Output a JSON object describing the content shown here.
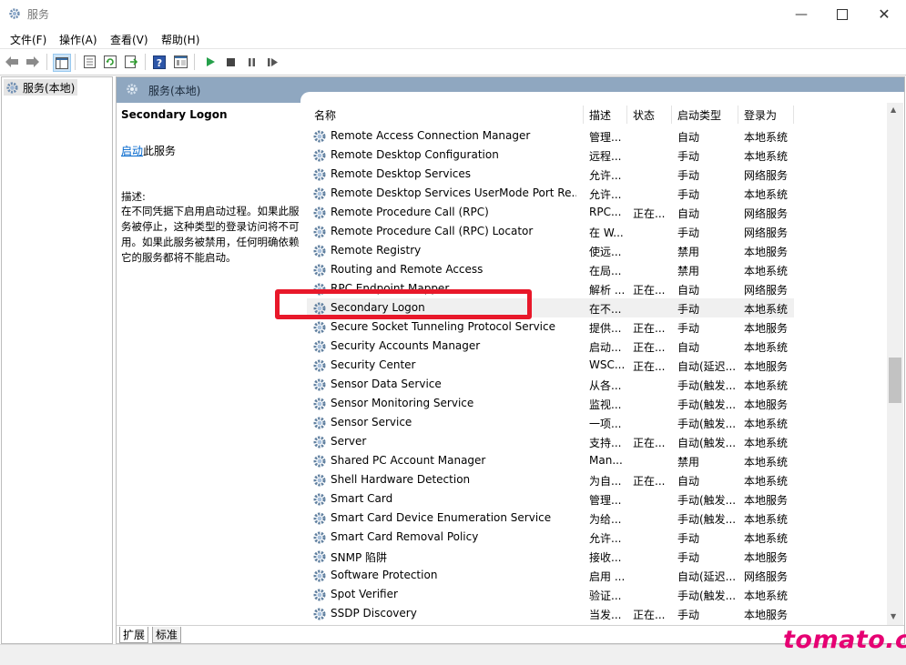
{
  "window": {
    "title": "服务"
  },
  "menu": [
    "文件(F)",
    "操作(A)",
    "查看(V)",
    "帮助(H)"
  ],
  "toolbar_icons": [
    "back-arrow-icon",
    "forward-arrow-icon",
    "show-console-tree-icon",
    "properties-icon",
    "refresh-icon",
    "export-list-icon",
    "help-icon",
    "extended-view-icon",
    "start-service-icon",
    "stop-service-icon",
    "pause-service-icon",
    "restart-service-icon"
  ],
  "tree": {
    "item": "服务(本地)"
  },
  "pane": {
    "header": "服务(本地)"
  },
  "desc": {
    "title": "Secondary Logon",
    "start_link": "启动",
    "start_suffix": "此服务",
    "label": "描述:",
    "body": "在不同凭据下启用启动过程。如果此服务被停止，这种类型的登录访问将不可用。如果此服务被禁用，任何明确依赖它的服务都将不能启动。"
  },
  "columns": {
    "name": "名称",
    "desc": "描述",
    "status": "状态",
    "startup": "启动类型",
    "logon": "登录为"
  },
  "services": [
    {
      "name": "Remote Access Connection Manager",
      "desc": "管理...",
      "status": "",
      "startup": "自动",
      "logon": "本地系统"
    },
    {
      "name": "Remote Desktop Configuration",
      "desc": "远程...",
      "status": "",
      "startup": "手动",
      "logon": "本地系统"
    },
    {
      "name": "Remote Desktop Services",
      "desc": "允许...",
      "status": "",
      "startup": "手动",
      "logon": "网络服务"
    },
    {
      "name": "Remote Desktop Services UserMode Port Re...",
      "desc": "允许...",
      "status": "",
      "startup": "手动",
      "logon": "本地系统"
    },
    {
      "name": "Remote Procedure Call (RPC)",
      "desc": "RPC...",
      "status": "正在...",
      "startup": "自动",
      "logon": "网络服务"
    },
    {
      "name": "Remote Procedure Call (RPC) Locator",
      "desc": "在 W...",
      "status": "",
      "startup": "手动",
      "logon": "网络服务"
    },
    {
      "name": "Remote Registry",
      "desc": "使远...",
      "status": "",
      "startup": "禁用",
      "logon": "本地服务"
    },
    {
      "name": "Routing and Remote Access",
      "desc": "在局...",
      "status": "",
      "startup": "禁用",
      "logon": "本地系统"
    },
    {
      "name": "RPC Endpoint Mapper",
      "desc": "解析 ...",
      "status": "正在...",
      "startup": "自动",
      "logon": "网络服务"
    },
    {
      "name": "Secondary Logon",
      "desc": "在不...",
      "status": "",
      "startup": "手动",
      "logon": "本地系统"
    },
    {
      "name": "Secure Socket Tunneling Protocol Service",
      "desc": "提供...",
      "status": "正在...",
      "startup": "手动",
      "logon": "本地服务"
    },
    {
      "name": "Security Accounts Manager",
      "desc": "启动...",
      "status": "正在...",
      "startup": "自动",
      "logon": "本地系统"
    },
    {
      "name": "Security Center",
      "desc": "WSC...",
      "status": "正在...",
      "startup": "自动(延迟...",
      "logon": "本地服务"
    },
    {
      "name": "Sensor Data Service",
      "desc": "从各...",
      "status": "",
      "startup": "手动(触发...",
      "logon": "本地系统"
    },
    {
      "name": "Sensor Monitoring Service",
      "desc": "监视...",
      "status": "",
      "startup": "手动(触发...",
      "logon": "本地服务"
    },
    {
      "name": "Sensor Service",
      "desc": "一项...",
      "status": "",
      "startup": "手动(触发...",
      "logon": "本地系统"
    },
    {
      "name": "Server",
      "desc": "支持...",
      "status": "正在...",
      "startup": "自动(触发...",
      "logon": "本地系统"
    },
    {
      "name": "Shared PC Account Manager",
      "desc": "Man...",
      "status": "",
      "startup": "禁用",
      "logon": "本地系统"
    },
    {
      "name": "Shell Hardware Detection",
      "desc": "为自...",
      "status": "正在...",
      "startup": "自动",
      "logon": "本地系统"
    },
    {
      "name": "Smart Card",
      "desc": "管理...",
      "status": "",
      "startup": "手动(触发...",
      "logon": "本地服务"
    },
    {
      "name": "Smart Card Device Enumeration Service",
      "desc": "为给...",
      "status": "",
      "startup": "手动(触发...",
      "logon": "本地系统"
    },
    {
      "name": "Smart Card Removal Policy",
      "desc": "允许...",
      "status": "",
      "startup": "手动",
      "logon": "本地系统"
    },
    {
      "name": "SNMP 陷阱",
      "desc": "接收...",
      "status": "",
      "startup": "手动",
      "logon": "本地服务"
    },
    {
      "name": "Software Protection",
      "desc": "启用 ...",
      "status": "",
      "startup": "自动(延迟...",
      "logon": "网络服务"
    },
    {
      "name": "Spot Verifier",
      "desc": "验证...",
      "status": "",
      "startup": "手动(触发...",
      "logon": "本地系统"
    },
    {
      "name": "SSDP Discovery",
      "desc": "当发...",
      "status": "正在...",
      "startup": "手动",
      "logon": "本地服务"
    }
  ],
  "bottom_tabs": [
    "扩展",
    "标准"
  ],
  "watermark": "tomato.cm",
  "colors": {
    "header": "#8fa7c0",
    "highlight": "#e8182a",
    "watermark": "#e60073",
    "link": "#0066cc"
  }
}
